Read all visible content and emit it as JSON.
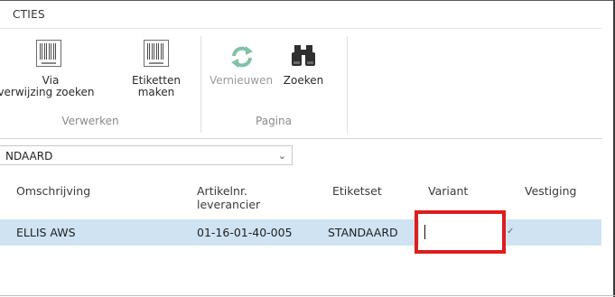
{
  "ribbon": {
    "tab_title": "CTIES",
    "groups": [
      {
        "label": "Verwerken",
        "buttons": [
          {
            "label_line1": "Via",
            "label_line2": "verwijzing zoeken",
            "icon": "barcode-icon"
          },
          {
            "label_line1": "Etiketten",
            "label_line2": "maken",
            "icon": "barcode-icon"
          }
        ]
      },
      {
        "label": "Pagina",
        "buttons": [
          {
            "label_line1": "Vernieuwen",
            "icon": "refresh-icon",
            "enabled": false
          },
          {
            "label_line1": "Zoeken",
            "icon": "binoculars-icon"
          }
        ]
      }
    ]
  },
  "filter": {
    "value": "NDAARD"
  },
  "table": {
    "columns": [
      {
        "line1": "Omschrijving"
      },
      {
        "line1": "Artikelnr.",
        "line2": "leverancier"
      },
      {
        "line1": "Etiketset"
      },
      {
        "line1": "Variant"
      },
      {
        "line1": "Vestiging"
      }
    ],
    "rows": [
      {
        "omschrijving": "ELLIS AWS",
        "artikelnr": "01-16-01-40-005",
        "etiketset": "STANDAARD",
        "variant": "",
        "vestiging": ""
      }
    ]
  },
  "colors": {
    "highlight": "#dc1e1e",
    "row_selected": "#cfe3f3",
    "refresh_icon": "#7fc3a4"
  }
}
